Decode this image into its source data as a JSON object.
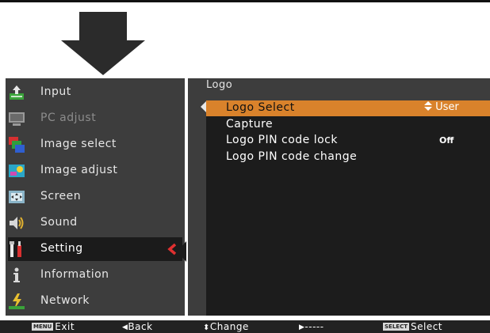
{
  "sidebar": {
    "items": [
      {
        "label": "Input",
        "icon": "input-icon"
      },
      {
        "label": "PC adjust",
        "icon": "monitor-icon"
      },
      {
        "label": "Image select",
        "icon": "image-select-icon"
      },
      {
        "label": "Image adjust",
        "icon": "image-adjust-icon"
      },
      {
        "label": "Screen",
        "icon": "screen-icon"
      },
      {
        "label": "Sound",
        "icon": "speaker-icon"
      },
      {
        "label": "Setting",
        "icon": "tools-icon"
      },
      {
        "label": "Information",
        "icon": "info-icon"
      },
      {
        "label": "Network",
        "icon": "network-icon"
      }
    ],
    "active_index": 6
  },
  "panel": {
    "title": "Logo",
    "rows": [
      {
        "label": "Logo Select",
        "value": "User",
        "selected": true
      },
      {
        "label": "Capture",
        "value": ""
      },
      {
        "label": "Logo PIN code lock",
        "value": "Off"
      },
      {
        "label": "Logo PIN code change",
        "value": ""
      }
    ]
  },
  "footer": {
    "exit_key": "MENU",
    "exit_label": "Exit",
    "back_label": "Back",
    "change_label": "Change",
    "next_label": "-----",
    "select_key": "SELECT",
    "select_label": "Select"
  },
  "colors": {
    "highlight": "#d9822b",
    "chevron": "#e03030",
    "panel_bg": "#3d3d3d",
    "inner_bg": "#1c1c1c"
  }
}
